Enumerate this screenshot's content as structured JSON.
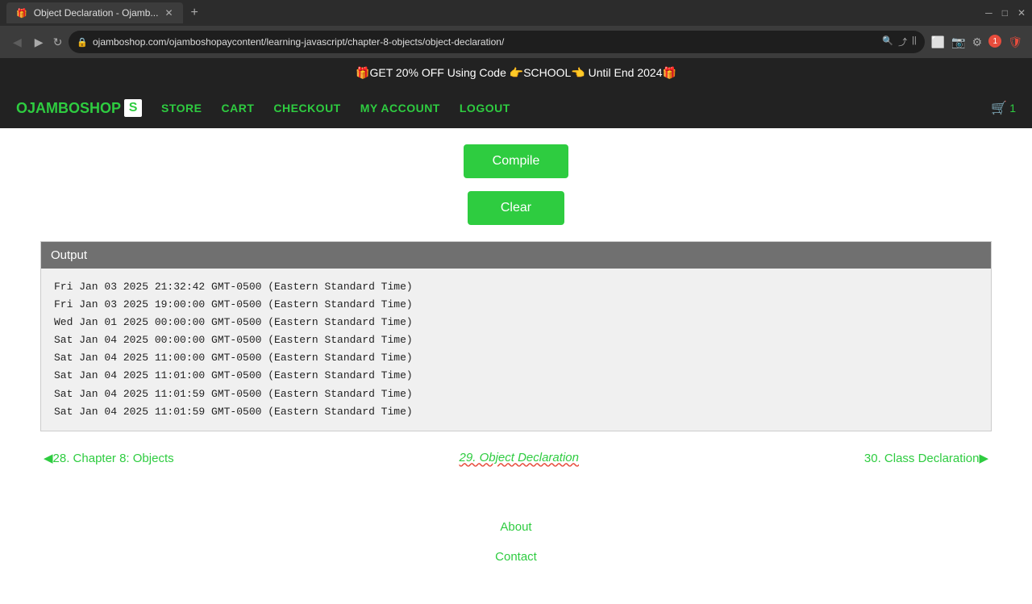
{
  "browser": {
    "tab_title": "Object Declaration - Ojamb...",
    "tab_favicon": "🎁",
    "address": "ojamboshop.com/ojamboshopaycontent/learning-javascript/chapter-8-objects/object-declaration/",
    "notification_count": "1"
  },
  "nav": {
    "logo_text": "OJAMBOSHOP",
    "logo_s": "S",
    "store": "STORE",
    "cart": "CART",
    "checkout": "CHECKOUT",
    "my_account": "MY ACCOUNT",
    "logout": "LOGOUT",
    "cart_icon": "🛒",
    "cart_count": "1"
  },
  "promo": {
    "text": "🎁GET 20% OFF Using Code 👉SCHOOL👈 Until End 2024🎁"
  },
  "buttons": {
    "compile": "Compile",
    "clear": "Clear"
  },
  "output": {
    "header": "Output",
    "lines": [
      "Fri Jan 03 2025 21:32:42 GMT-0500 (Eastern Standard Time)",
      "Fri Jan 03 2025 19:00:00 GMT-0500 (Eastern Standard Time)",
      "Wed Jan 01 2025 00:00:00 GMT-0500 (Eastern Standard Time)",
      "Sat Jan 04 2025 00:00:00 GMT-0500 (Eastern Standard Time)",
      "Sat Jan 04 2025 11:00:00 GMT-0500 (Eastern Standard Time)",
      "Sat Jan 04 2025 11:01:00 GMT-0500 (Eastern Standard Time)",
      "Sat Jan 04 2025 11:01:59 GMT-0500 (Eastern Standard Time)",
      "Sat Jan 04 2025 11:01:59 GMT-0500 (Eastern Standard Time)"
    ]
  },
  "pagination": {
    "prev_label": "◀28. Chapter 8: Objects",
    "current_label": "29. Object Declaration",
    "next_label": "30. Class Declaration▶"
  },
  "footer": {
    "about": "About",
    "contact": "Contact"
  }
}
